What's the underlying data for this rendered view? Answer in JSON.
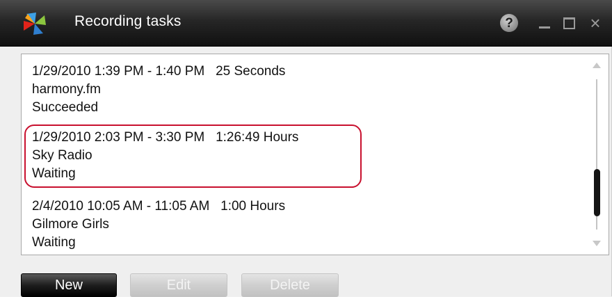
{
  "window": {
    "title": "Recording tasks",
    "help_glyph": "?",
    "close_glyph": "×",
    "logo_icon": "pinwheel-logo-icon"
  },
  "tasks": [
    {
      "time_range": "1/29/2010 1:39 PM - 1:40 PM",
      "duration": "25 Seconds",
      "station": "harmony.fm",
      "status": "Succeeded"
    },
    {
      "time_range": "1/29/2010 2:03 PM - 3:30 PM",
      "duration": "1:26:49 Hours",
      "station": "Sky Radio",
      "status": "Waiting"
    },
    {
      "time_range": "2/4/2010 10:05 AM - 11:05 AM",
      "duration": "1:00 Hours",
      "station": "Gilmore Girls",
      "status": "Waiting"
    }
  ],
  "buttons": {
    "new_label": "New",
    "edit_label": "Edit",
    "delete_label": "Delete"
  },
  "colors": {
    "highlight": "#c8102e",
    "titlebar": "#1a1a1a"
  }
}
